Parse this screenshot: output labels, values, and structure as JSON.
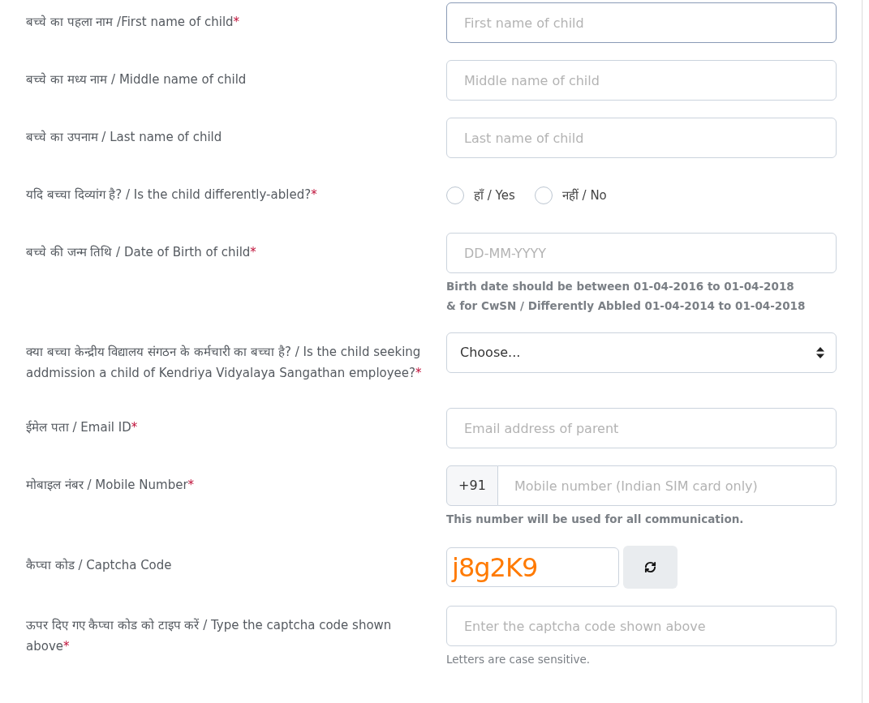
{
  "form": {
    "fields": [
      {
        "kind": "text",
        "label": "बच्चे का पहला नाम /First name of child",
        "required_mark": "*",
        "placeholder": "First name of child",
        "focused": true
      },
      {
        "kind": "text",
        "label": "बच्चे का मध्य नाम / Middle name of child",
        "placeholder": "Middle name of child",
        "focused": false
      },
      {
        "kind": "text",
        "label": "बच्चे का उपनाम / Last name of child",
        "placeholder": "Last name of child",
        "focused": false
      },
      {
        "kind": "radio",
        "label": "यदि बच्चा दिव्यांग है? / Is the child differently-abled?",
        "required_mark": "*",
        "options": [
          {
            "label": "हाँ / Yes",
            "selected": false
          },
          {
            "label": "नहीं / No",
            "selected": false
          }
        ]
      },
      {
        "kind": "text",
        "label": "बच्चे की जन्म तिथि / Date of Birth of child",
        "required_mark": "*",
        "placeholder": "DD-MM-YYYY",
        "focused": false,
        "help": [
          "Birth date should be between 01-04-2016 to 01-04-2018",
          "& for CwSN / Differently Abbled 01-04-2014 to 01-04-2018"
        ],
        "help_bold": true
      },
      {
        "kind": "select",
        "label": "क्या बच्चा केन्द्रीय विद्यालय संगठन के कर्मचारी का बच्चा है? / Is the child seeking addmission a child of Kendriya Vidyalaya Sangathan employee?",
        "required_mark": "*",
        "value": "Choose..."
      },
      {
        "kind": "text",
        "label": "ईमेल पता / Email ID",
        "required_mark": "*",
        "placeholder": "Email address of parent",
        "focused": false
      },
      {
        "kind": "phone",
        "label": "मोबाइल नंबर / Mobile Number",
        "required_mark": "*",
        "prefix": "+91",
        "placeholder": "Mobile number (Indian SIM card only)",
        "help": [
          "This number will be used for all communication."
        ],
        "help_bold": true
      },
      {
        "kind": "captcha",
        "label": "कैप्चा कोड / Captcha Code",
        "code": "j8g2K9"
      },
      {
        "kind": "text",
        "label": "ऊपर दिए गए कैप्चा कोड को टाइप करें / Type the captcha code shown above",
        "required_mark": "*",
        "placeholder": "Enter the captcha code shown above",
        "focused": false,
        "help": [
          "Letters are case sensitive."
        ],
        "help_bold": false
      }
    ]
  }
}
